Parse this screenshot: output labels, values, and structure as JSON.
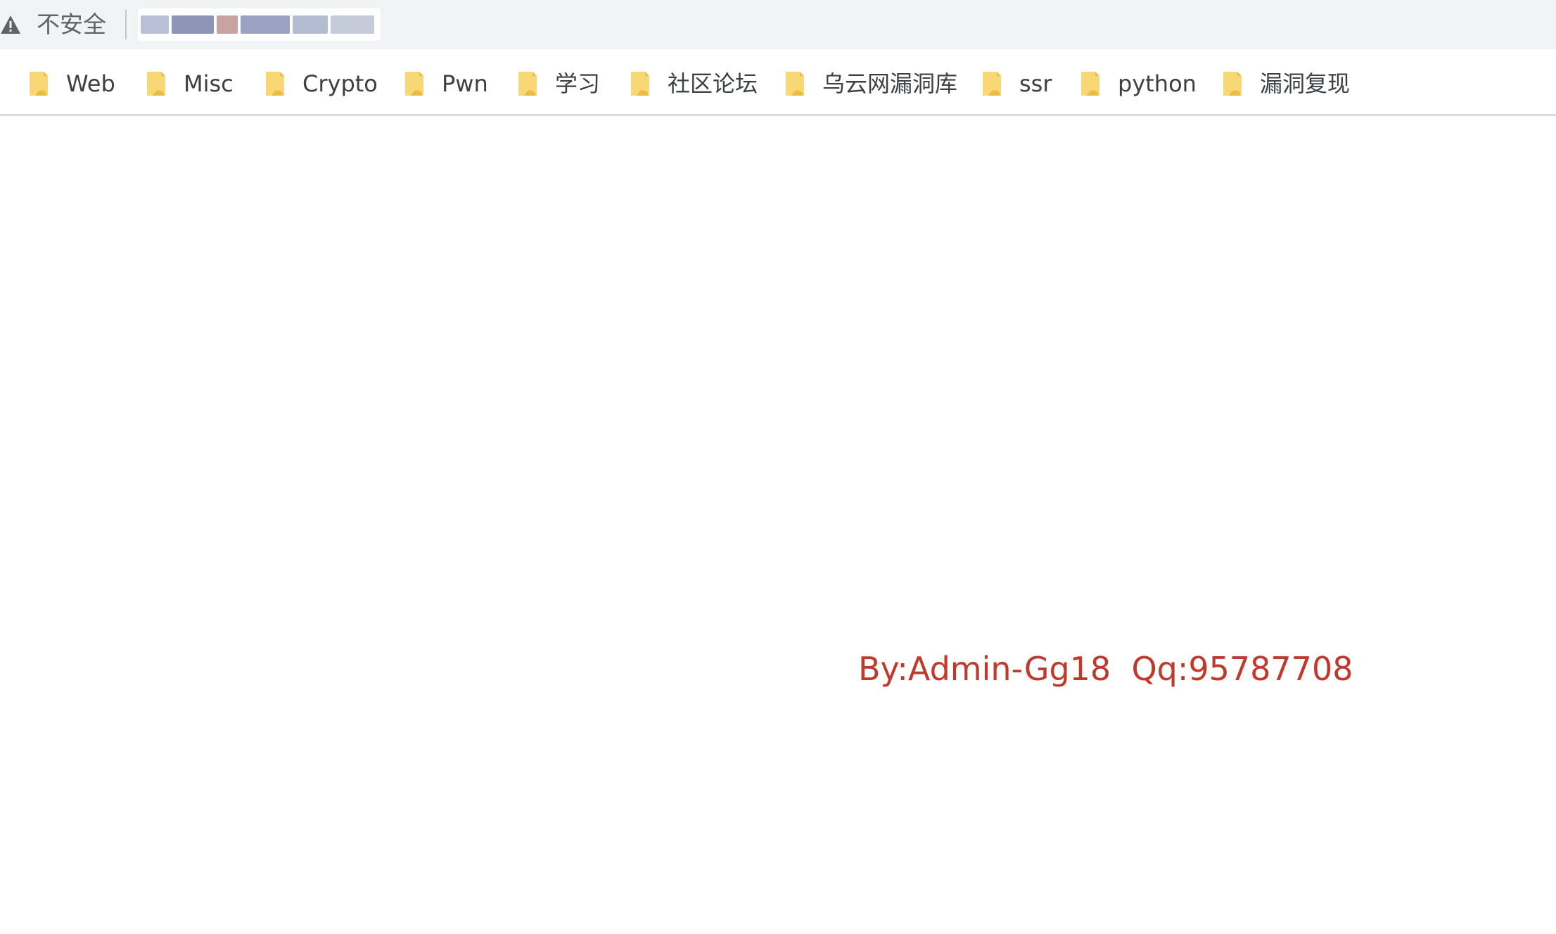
{
  "browser": {
    "security_label": "不安全",
    "url_obscured": true
  },
  "bookmarks": [
    {
      "label": "Web",
      "icon": "folder-icon"
    },
    {
      "label": "Misc",
      "icon": "folder-icon"
    },
    {
      "label": "Crypto",
      "icon": "folder-icon"
    },
    {
      "label": "Pwn",
      "icon": "folder-icon"
    },
    {
      "label": "学习",
      "icon": "folder-icon"
    },
    {
      "label": "社区论坛",
      "icon": "folder-icon"
    },
    {
      "label": "乌云网漏洞库",
      "icon": "folder-icon"
    },
    {
      "label": "ssr",
      "icon": "folder-icon"
    },
    {
      "label": "python",
      "icon": "folder-icon"
    },
    {
      "label": "漏洞复现",
      "icon": "folder-icon"
    }
  ],
  "page": {
    "credit_text": "By:Admin-Gg18  Qq:95787708"
  },
  "colors": {
    "credit": "#c0392b",
    "folder": "#f8d775",
    "folder_dark": "#e9bd45"
  }
}
